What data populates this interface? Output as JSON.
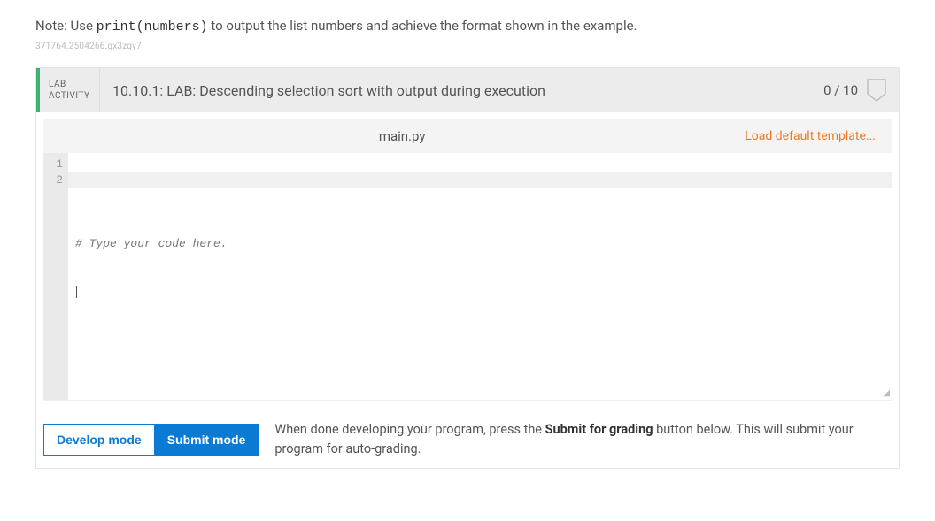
{
  "note": {
    "prefix": "Note: Use ",
    "code": "print(numbers)",
    "suffix": " to output the list numbers and achieve the format shown in the example."
  },
  "watermark": "371764.2504266.qx3zqy7",
  "lab": {
    "tag_line1": "LAB",
    "tag_line2": "ACTIVITY",
    "title": "10.10.1: LAB: Descending selection sort with output during execution",
    "score": "0 / 10"
  },
  "editor": {
    "filename": "main.py",
    "load_template_label": "Load default template...",
    "lines": {
      "l1_num": "1",
      "l2_num": "2",
      "l1_text": "# Type your code here."
    }
  },
  "modes": {
    "develop": "Develop mode",
    "submit": "Submit mode",
    "desc_prefix": "When done developing your program, press the ",
    "desc_bold": "Submit for grading",
    "desc_suffix": " button below. This will submit your program for auto-grading."
  }
}
